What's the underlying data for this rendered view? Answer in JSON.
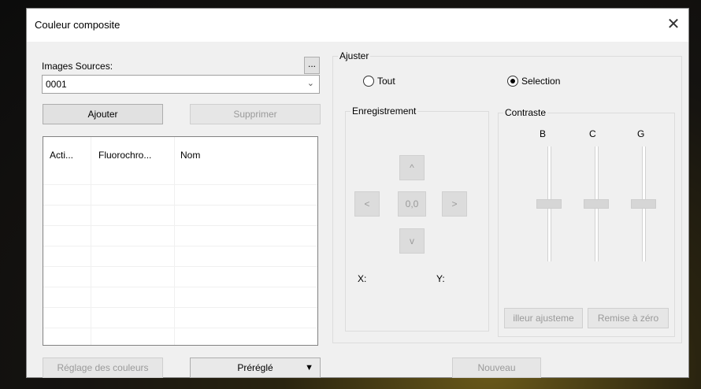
{
  "window": {
    "title": "Couleur composite",
    "close_glyph": "✕"
  },
  "sources": {
    "label": "Images Sources:",
    "browse_label": "...",
    "selected": "0001",
    "add_label": "Ajouter",
    "remove_label": "Supprimer"
  },
  "table": {
    "columns": [
      "Acti...",
      "Fluorochro...",
      "Nom"
    ],
    "rows": []
  },
  "bottom": {
    "color_settings_label": "Réglage des couleurs",
    "preset_label": "Préréglé",
    "new_label": "Nouveau"
  },
  "adjust": {
    "title": "Ajuster",
    "option_all": "Tout",
    "option_selection": "Selection",
    "selected_option": "Selection"
  },
  "registration": {
    "title": "Enregistrement",
    "up": "^",
    "left": "<",
    "center": "0,0",
    "right": ">",
    "down": "v",
    "x_label": "X:",
    "y_label": "Y:"
  },
  "contrast": {
    "title": "Contraste",
    "channels": [
      {
        "label": "B",
        "level": 0.5
      },
      {
        "label": "C",
        "level": 0.5
      },
      {
        "label": "G",
        "level": 0.5
      }
    ],
    "auto_label": "illeur ajusteme",
    "reset_label": "Remise à zéro"
  }
}
